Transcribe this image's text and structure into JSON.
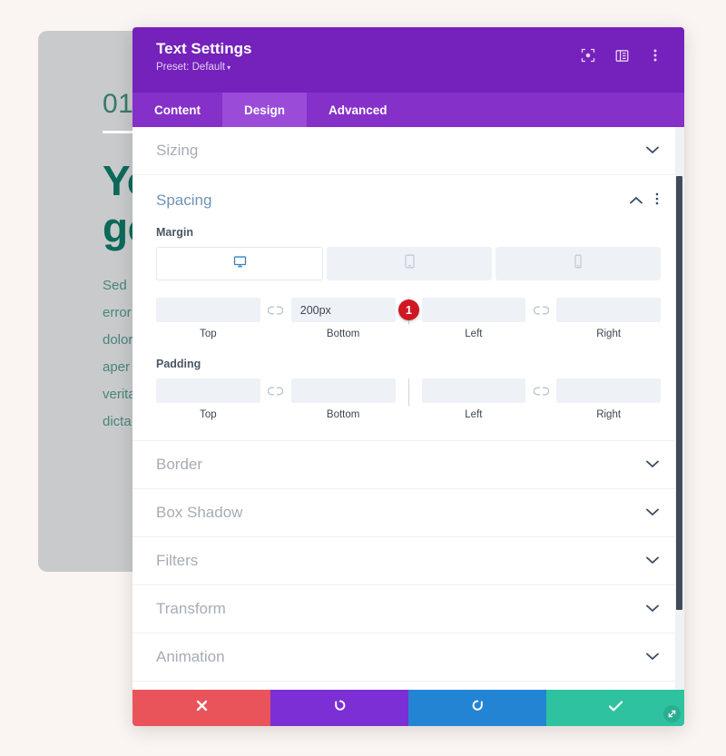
{
  "background": {
    "number": "01",
    "heading_line1": "Yo",
    "heading_line2": "go",
    "body_lines": [
      "Sed",
      "error",
      "dolor",
      "aper",
      "verita",
      "dicta"
    ]
  },
  "modal": {
    "title": "Text Settings",
    "preset_label": "Preset: Default",
    "preset_caret": "▾",
    "header_icons": [
      {
        "name": "focus-target-icon"
      },
      {
        "name": "layout-panel-icon"
      },
      {
        "name": "more-vertical-icon"
      }
    ],
    "tabs": [
      {
        "label": "Content",
        "active": false
      },
      {
        "label": "Design",
        "active": true
      },
      {
        "label": "Advanced",
        "active": false
      }
    ],
    "sections": {
      "sizing": {
        "label": "Sizing",
        "expanded": false,
        "chevron": "chevron-down-icon"
      },
      "spacing": {
        "label": "Spacing",
        "expanded": true,
        "chevron": "chevron-up-icon"
      },
      "border": {
        "label": "Border",
        "expanded": false
      },
      "box_shadow": {
        "label": "Box Shadow",
        "expanded": false
      },
      "filters": {
        "label": "Filters",
        "expanded": false
      },
      "transform": {
        "label": "Transform",
        "expanded": false
      },
      "animation": {
        "label": "Animation",
        "expanded": false
      }
    },
    "spacing": {
      "device_tabs": [
        {
          "icon": "desktop-icon",
          "active": true
        },
        {
          "icon": "tablet-icon",
          "active": false
        },
        {
          "icon": "phone-icon",
          "active": false
        }
      ],
      "margin": {
        "title": "Margin",
        "fields": [
          {
            "label": "Top",
            "value": "",
            "placeholder": ""
          },
          {
            "label": "Bottom",
            "value": "200px",
            "placeholder": ""
          },
          {
            "label": "Left",
            "value": "",
            "placeholder": ""
          },
          {
            "label": "Right",
            "value": "",
            "placeholder": ""
          }
        ]
      },
      "padding": {
        "title": "Padding",
        "fields": [
          {
            "label": "Top",
            "value": "",
            "placeholder": ""
          },
          {
            "label": "Bottom",
            "value": "",
            "placeholder": ""
          },
          {
            "label": "Left",
            "value": "",
            "placeholder": ""
          },
          {
            "label": "Right",
            "value": "",
            "placeholder": ""
          }
        ]
      }
    },
    "annotation_marker": "1",
    "footer": [
      {
        "name": "cancel",
        "icon": "close-x-icon",
        "glyph": "✕",
        "color": "#e8545a"
      },
      {
        "name": "undo",
        "icon": "undo-icon",
        "glyph": "↺",
        "color": "#7b2fd4"
      },
      {
        "name": "redo",
        "icon": "redo-icon",
        "glyph": "↻",
        "color": "#2384d4"
      },
      {
        "name": "save",
        "icon": "check-icon",
        "glyph": "✓",
        "color": "#2ec2a0"
      }
    ],
    "resize_handle_icon": "resize-diagonal-icon"
  },
  "colors": {
    "header_purple": "#7521bb",
    "tabbar_purple": "#8530c9",
    "tab_active_purple": "#9a4bd8",
    "marker_red": "#cf1724",
    "accent_blue": "#6e93b8",
    "page_bg": "#faf4f2",
    "card_gray": "#c8cacb",
    "heading_green": "#0c6a5a"
  }
}
